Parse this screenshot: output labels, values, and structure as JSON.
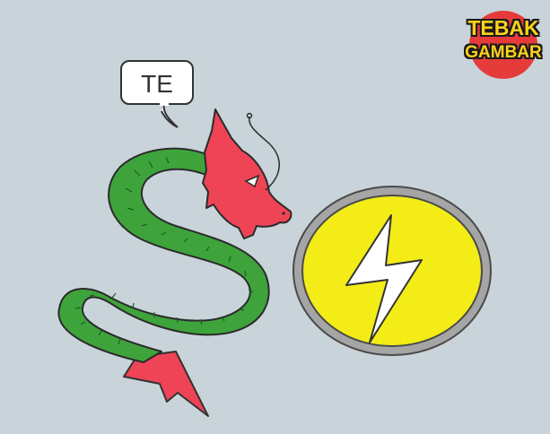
{
  "logo": {
    "line1": "TEBAK",
    "line2": "GAMBAR"
  },
  "puzzle": {
    "speech_bubble_text": "TE",
    "clue_1_icon": "dragon-icon",
    "clue_2_icon": "lightning-bolt-icon"
  },
  "colors": {
    "background": "#c9d4da",
    "dragon_body": "#3fa33c",
    "dragon_head": "#ee4456",
    "coin_fill": "#f4ec17",
    "coin_rim": "#a5a5a5",
    "logo_badge": "#e63b3b",
    "logo_text": "#ffd21a"
  }
}
